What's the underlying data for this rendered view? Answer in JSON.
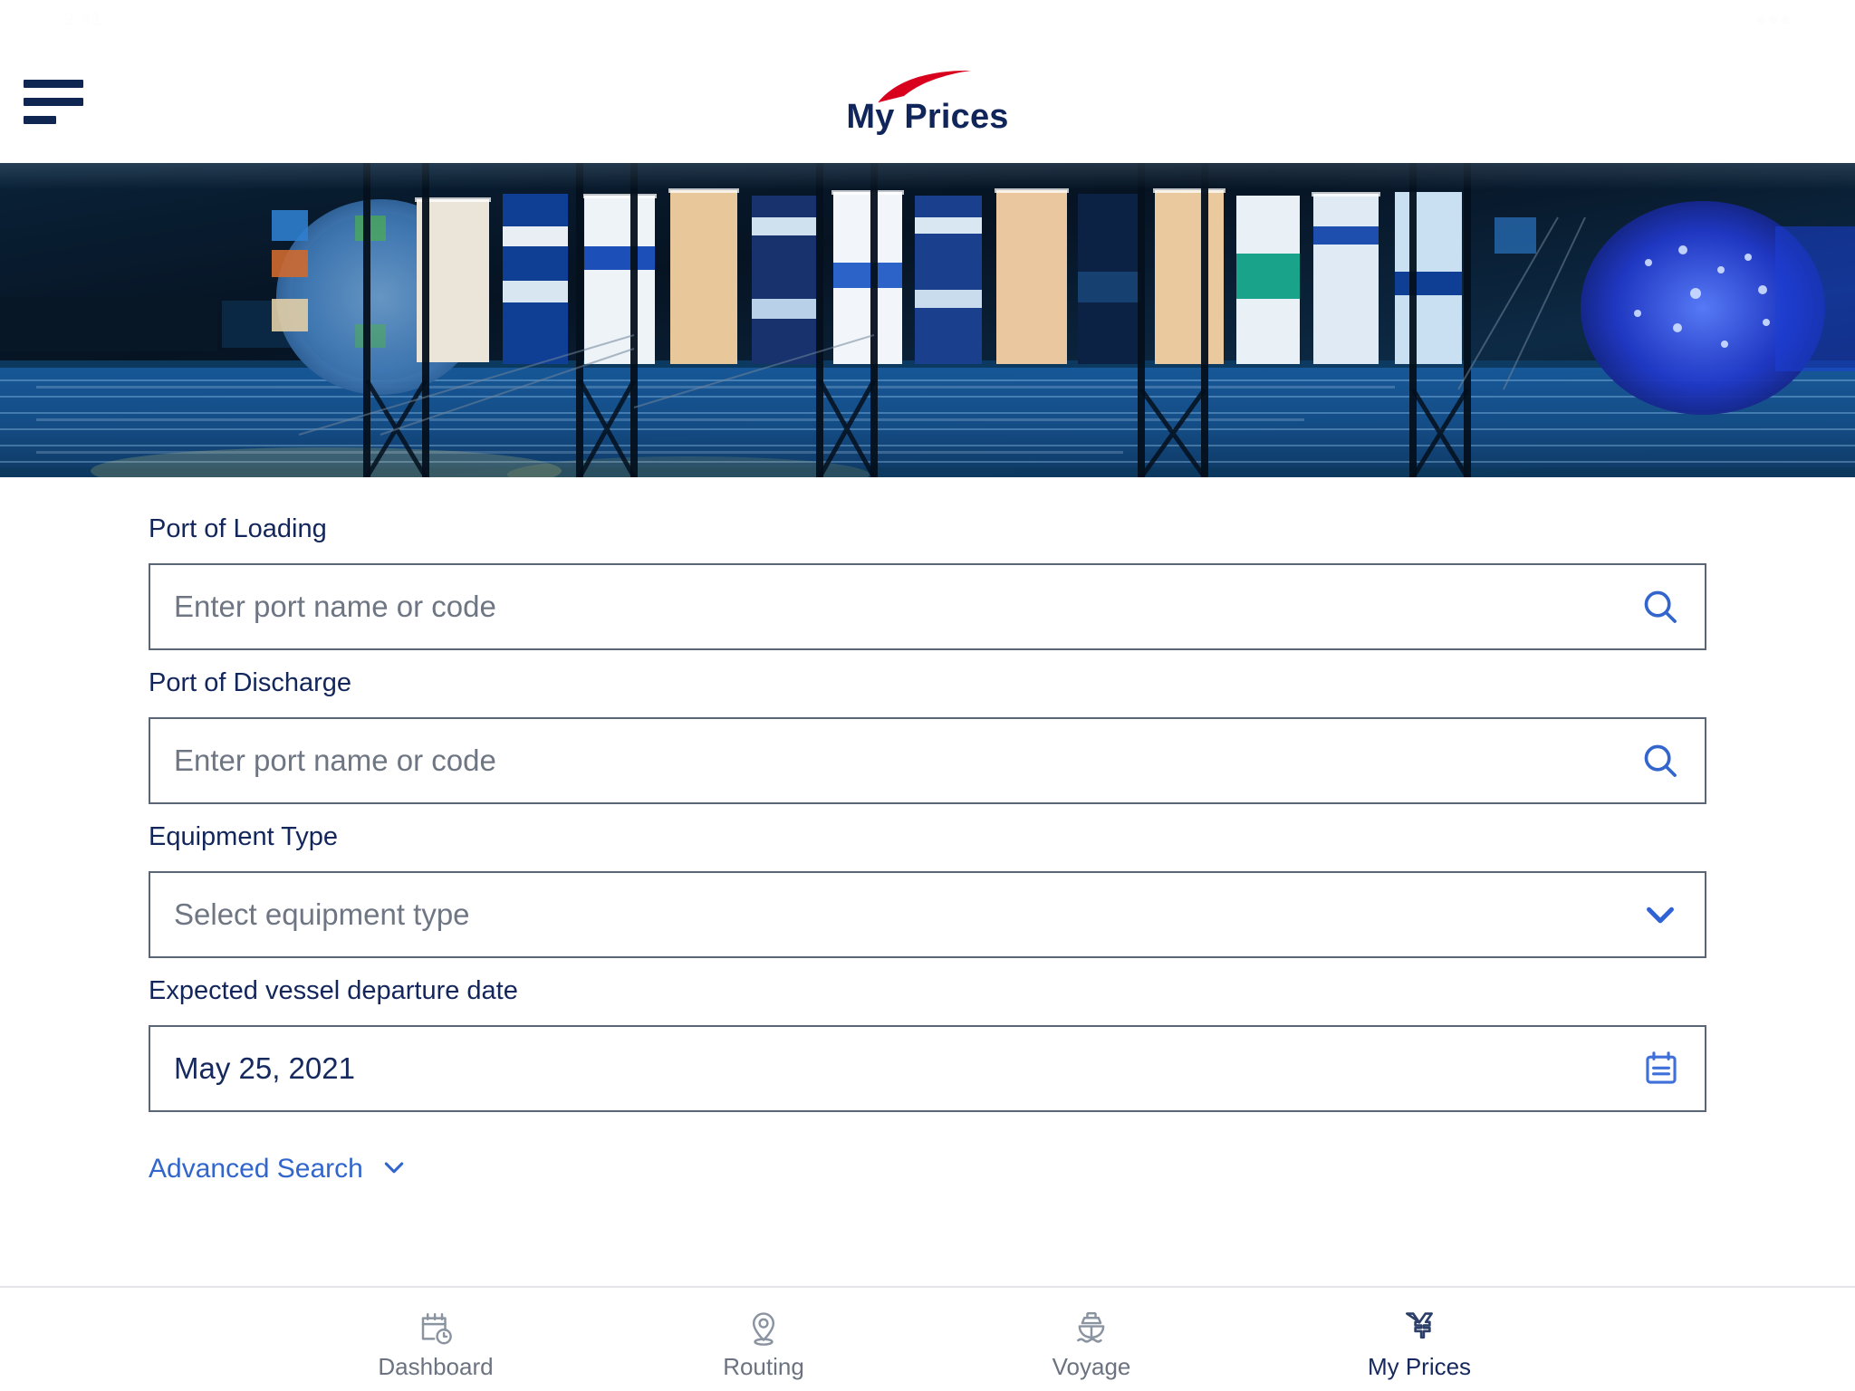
{
  "status_bar": {
    "time": "9:41",
    "indicators": "●●●"
  },
  "header": {
    "menu_icon": "hamburger-menu-icon",
    "logo_icon": "cma-cgm-swoosh-logo",
    "title": "My Prices",
    "title_color": "#10255a",
    "logo_color": "#d8001d"
  },
  "hero": {
    "alt": "aerial-night-view-container-ship-at-port",
    "base_color": "#041024"
  },
  "form": {
    "fields": [
      {
        "label": "Port of Loading",
        "value": "",
        "placeholder": "Enter port name or code",
        "icon": "search-icon",
        "icon_color": "#3366cc",
        "type": "search"
      },
      {
        "label": "Port of Discharge",
        "value": "",
        "placeholder": "Enter port name or code",
        "icon": "search-icon",
        "icon_color": "#3366cc",
        "type": "search"
      },
      {
        "label": "Equipment Type",
        "value": "",
        "placeholder": "Select equipment type",
        "icon": "chevron-down-icon",
        "icon_color": "#2f62d4",
        "type": "select"
      },
      {
        "label": "Expected vessel departure date",
        "value": "May 25, 2021",
        "placeholder": "",
        "icon": "calendar-icon",
        "icon_color": "#3f6fd8",
        "type": "date"
      }
    ],
    "advanced_search": {
      "label": "Advanced Search",
      "icon": "chevron-down-icon",
      "color": "#3366cc"
    }
  },
  "bottom_nav": {
    "items": [
      {
        "label": "Dashboard",
        "icon": "calendar-clock-icon",
        "active": false
      },
      {
        "label": "Routing",
        "icon": "location-pin-icon",
        "active": false
      },
      {
        "label": "Voyage",
        "icon": "ship-icon",
        "active": false
      },
      {
        "label": "My Prices",
        "icon": "yen-currency-icon",
        "active": true
      }
    ],
    "inactive_color": "#6b7280",
    "active_color": "#16295e"
  }
}
